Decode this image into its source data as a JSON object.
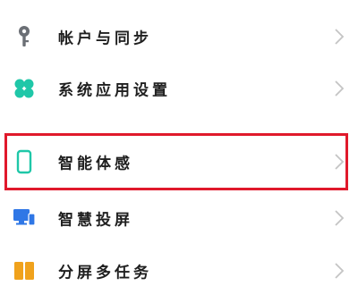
{
  "settings": {
    "items": [
      {
        "label": "帐户与同步",
        "icon": "key-icon"
      },
      {
        "label": "系统应用设置",
        "icon": "apps-clover-icon"
      },
      {
        "label": "智能体感",
        "icon": "phone-outline-icon"
      },
      {
        "label": "智慧投屏",
        "icon": "screen-cast-icon"
      },
      {
        "label": "分屏多任务",
        "icon": "split-screen-icon"
      }
    ]
  },
  "colors": {
    "key_icon": "#6b6f75",
    "apps_icon": "#1fc7a8",
    "phone_icon": "#1fc7a8",
    "cast_icon": "#2f77e6",
    "split_icon": "#f0a21c",
    "highlight": "#e0192b",
    "chevron": "#c4c4c4"
  }
}
